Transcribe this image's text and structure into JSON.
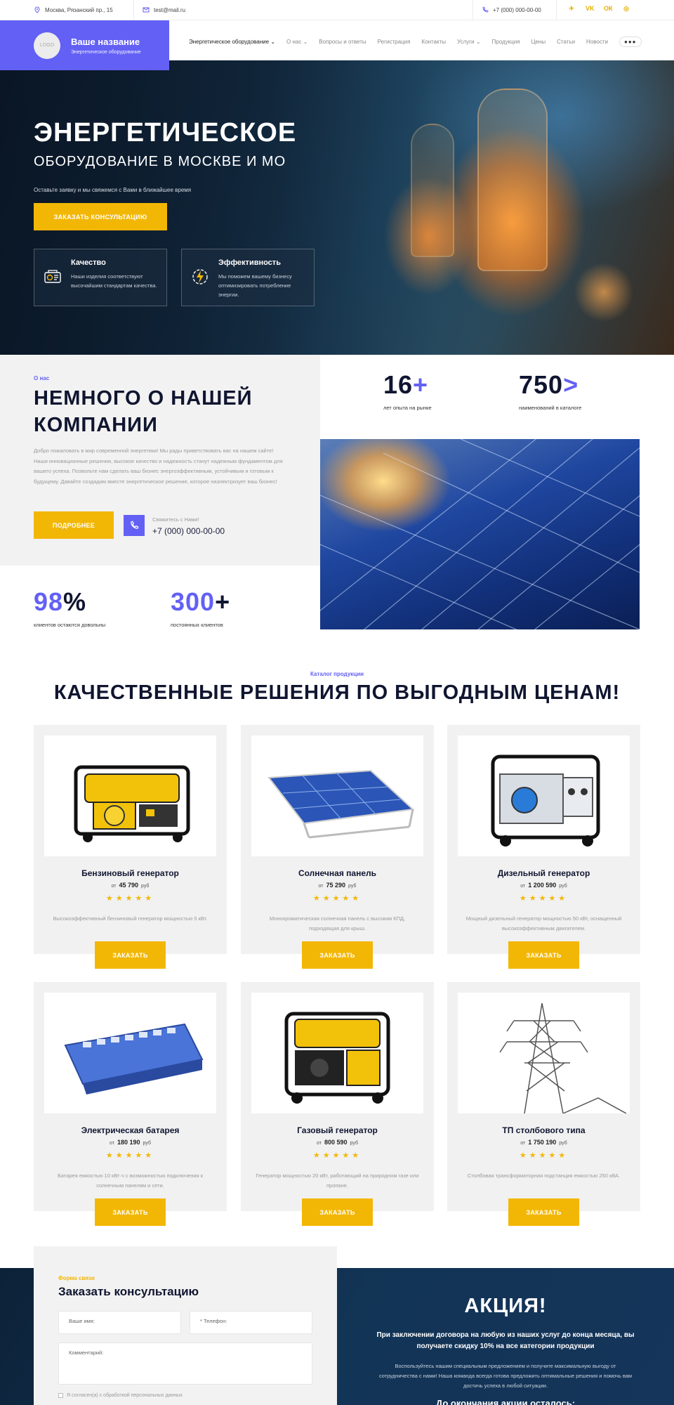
{
  "topbar": {
    "address": "Москва, Рязанский пр., 15",
    "email": "test@mail.ru",
    "phone": "+7 (000) 000-00-00",
    "socials": [
      "telegram-icon",
      "vk-icon",
      "odnoklassniki-icon",
      "whatsapp-icon"
    ],
    "social_labels": [
      "✈",
      "VK",
      "ОК",
      "◎"
    ]
  },
  "header": {
    "logo": "LOGO",
    "brand_name": "Ваше название",
    "brand_sub": "Энергетическое оборудование",
    "nav": [
      {
        "label": "Энергетическое оборудование",
        "dropdown": true
      },
      {
        "label": "О нас",
        "dropdown": true
      },
      {
        "label": "Вопросы и ответы",
        "dropdown": false
      },
      {
        "label": "Регистрация",
        "dropdown": false
      },
      {
        "label": "Контакты",
        "dropdown": false
      },
      {
        "label": "Услуги",
        "dropdown": true
      },
      {
        "label": "Продукция",
        "dropdown": false
      },
      {
        "label": "Цены",
        "dropdown": false
      },
      {
        "label": "Статьи",
        "dropdown": false
      },
      {
        "label": "Новости",
        "dropdown": false
      }
    ],
    "more": "●●●"
  },
  "hero": {
    "title_line1": "ЭНЕРГЕТИЧЕСКОЕ",
    "title_line2": "ОБОРУДОВАНИЕ В МОСКВЕ И МО",
    "subtitle": "Оставьте заявку и мы свяжемся с Вами в ближайшее время",
    "cta": "ЗАКАЗАТЬ КОНСУЛЬТАЦИЮ",
    "features": [
      {
        "title": "Качество",
        "text": "Наши изделия соответствуют высочайшим стандартам качества.",
        "icon": "quality-badge-icon"
      },
      {
        "title": "Эффективность",
        "text": "Мы поможем вашему бизнесу оптимизировать потребление энергии.",
        "icon": "lightning-gear-icon"
      }
    ]
  },
  "about": {
    "label": "О нас",
    "title": "НЕМНОГО О НАШЕЙ КОМПАНИИ",
    "text": "Добро пожаловать в мир современной энергетики! Мы рады приветствовать вас на нашем сайте! Наши инновационные решения, высокое качество и надежность станут надежным фундаментом для вашего успеха. Позвольте нам сделать ваш бизнес энергоэффективным, устойчивым и готовым к будущему. Давайте создадим вместе энергетическое решение, которое наэлектризует ваш бизнес!",
    "button": "ПОДРОБНЕЕ",
    "contact_label": "Свяжитесь с Нами!",
    "contact_phone": "+7 (000) 000-00-00",
    "stats": [
      {
        "value": "16",
        "suffix": "+",
        "label": "лет опыта на рынке"
      },
      {
        "value": "750",
        "suffix": ">",
        "label": "наименований в каталоге"
      },
      {
        "value": "98",
        "suffix": "%",
        "label": "клиентов остаются довольны"
      },
      {
        "value": "300",
        "suffix": "+",
        "label": "постоянных клиентов"
      }
    ]
  },
  "catalog": {
    "label": "Каталог продукции",
    "title": "КАЧЕСТВЕННЫЕ РЕШЕНИЯ ПО ВЫГОДНЫМ ЦЕНАМ!",
    "price_prefix": "от",
    "currency": "руб",
    "stars": "★★★★★",
    "order_button": "ЗАКАЗАТЬ",
    "products": [
      {
        "name": "Бензиновый генератор",
        "price": "45 790",
        "desc": "Высокоэффективный бензиновый генератор мощностью 5 кВт.",
        "image": "petrol-generator"
      },
      {
        "name": "Солнечная панель",
        "price": "75 290",
        "desc": "Монохроматическая солнечная панель с высоким КПД, подходящая для крыш.",
        "image": "solar-panel"
      },
      {
        "name": "Дизельный генератор",
        "price": "1 200 590",
        "desc": "Мощный дизельный генератор мощностью 50 кВт, оснащенный высокоэффективным двигателем.",
        "image": "diesel-generator"
      },
      {
        "name": "Электрическая батарея",
        "price": "180 190",
        "desc": "Батарея емкостью 10 кВт·ч с возможностью подключения к солнечным панелям и сети.",
        "image": "battery"
      },
      {
        "name": "Газовый генератор",
        "price": "800 590",
        "desc": "Генератор мощностью 20 кВт, работающий на природном газе или пропане.",
        "image": "gas-generator"
      },
      {
        "name": "ТП столбового типа",
        "price": "1 750 190",
        "desc": "Столбовая трансформаторная подстанция емкостью 250 кВА.",
        "image": "transmission-tower"
      }
    ]
  },
  "form": {
    "label": "Форма связи",
    "title": "Заказать консультацию",
    "name_placeholder": "Ваше имя:",
    "phone_placeholder": "* Телефон:",
    "comment_placeholder": "Комментарий:",
    "consent": "Я согласен(а) с обработкой персональных данных"
  },
  "promo": {
    "title": "АКЦИЯ!",
    "bold": "При заключении договора на любую из наших услуг до конца месяца, вы получаете скидку 10% на все категории продукции",
    "text": "Воспользуйтесь нашим специальным предложением и получите максимальную выгоду от сотрудничества с нами! Наша команда всегда готова предложить оптимальные решения и помочь вам достичь успеха в любой ситуации.",
    "cut": "До окончания акции осталось:"
  },
  "colors": {
    "accent": "#6360f5",
    "button": "#f2b705",
    "dark": "#101530"
  }
}
